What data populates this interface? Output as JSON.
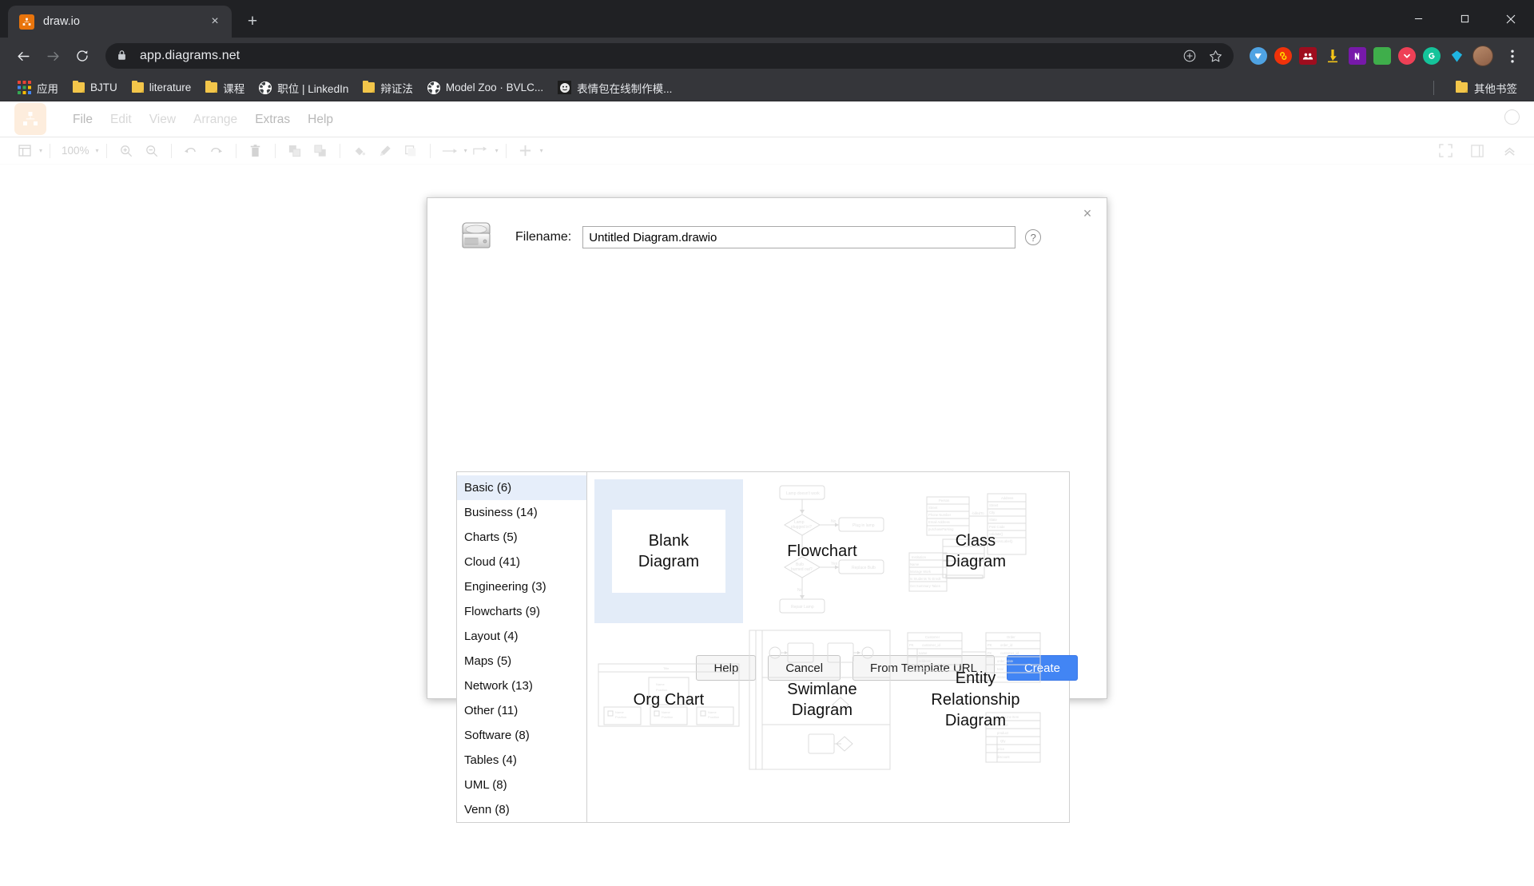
{
  "browser": {
    "tab": {
      "title": "draw.io",
      "favicon": "drawio-icon",
      "close": "×"
    },
    "new_tab_label": "+",
    "window_controls": {
      "minimize": "minimize-icon",
      "maximize": "maximize-icon",
      "close": "close-icon"
    },
    "nav": {
      "back": "back-arrow-icon",
      "forward": "forward-arrow-icon",
      "reload": "reload-icon"
    },
    "omnibox": {
      "url": "app.diagrams.net",
      "lock": "lock-icon",
      "install": "install-app-icon",
      "bookmark": "star-icon"
    },
    "extensions": [
      {
        "name": "extension-blue-v",
        "color": "#4fa3e3"
      },
      {
        "name": "extension-infinity",
        "color": "#f0320a"
      },
      {
        "name": "extension-red-people",
        "color": "#9e0d1e"
      },
      {
        "name": "extension-download",
        "color": "#f5c518"
      },
      {
        "name": "extension-onenote",
        "color": "#7719aa"
      },
      {
        "name": "extension-green",
        "color": "#3fae4b"
      },
      {
        "name": "extension-pocket",
        "color": "#ee4056"
      },
      {
        "name": "extension-grammarly",
        "color": "#15c39a"
      },
      {
        "name": "extension-diamond",
        "color": "#1fb5e2"
      }
    ],
    "profile": "profile-avatar",
    "menu": "three-dot-menu-icon",
    "bookmarks": [
      {
        "label": "应用",
        "icon": "apps-grid-icon"
      },
      {
        "label": "BJTU",
        "icon": "folder-icon"
      },
      {
        "label": "literature",
        "icon": "folder-icon"
      },
      {
        "label": "课程",
        "icon": "folder-icon"
      },
      {
        "label": "职位 | LinkedIn",
        "icon": "globe-icon"
      },
      {
        "label": "辩证法",
        "icon": "folder-icon"
      },
      {
        "label": "Model Zoo · BVLC...",
        "icon": "globe-icon"
      },
      {
        "label": "表情包在线制作模...",
        "icon": "smiley-icon"
      }
    ],
    "other_bookmarks": {
      "label": "其他书签",
      "icon": "folder-icon"
    }
  },
  "drawio": {
    "logo": "drawio-logo",
    "menus": [
      {
        "label": "File",
        "enabled": true
      },
      {
        "label": "Edit",
        "enabled": false
      },
      {
        "label": "View",
        "enabled": false
      },
      {
        "label": "Arrange",
        "enabled": false
      },
      {
        "label": "Extras",
        "enabled": true
      },
      {
        "label": "Help",
        "enabled": true
      }
    ],
    "toolbar": {
      "zoom_level": "100%",
      "icons": [
        "page-view-icon",
        "zoom-in-icon",
        "zoom-out-icon",
        "undo-icon",
        "redo-icon",
        "delete-icon",
        "to-front-icon",
        "to-back-icon",
        "fill-color-icon",
        "line-color-icon",
        "shadow-icon",
        "connection-icon",
        "waypoints-icon",
        "insert-icon"
      ],
      "right_icons": [
        "fullscreen-icon",
        "format-panel-icon",
        "collapse-icon"
      ]
    },
    "language_icon": "globe-icon"
  },
  "dialog": {
    "close_label": "×",
    "storage_icon": "hard-drive-icon",
    "filename_label": "Filename:",
    "filename_value": "Untitled Diagram.drawio",
    "filename_placeholder": "Untitled Diagram.drawio",
    "help_icon": "question-mark-icon",
    "categories": [
      {
        "label": "Basic (6)",
        "selected": true
      },
      {
        "label": "Business (14)",
        "selected": false
      },
      {
        "label": "Charts (5)",
        "selected": false
      },
      {
        "label": "Cloud (41)",
        "selected": false
      },
      {
        "label": "Engineering (3)",
        "selected": false
      },
      {
        "label": "Flowcharts (9)",
        "selected": false
      },
      {
        "label": "Layout (4)",
        "selected": false
      },
      {
        "label": "Maps (5)",
        "selected": false
      },
      {
        "label": "Network (13)",
        "selected": false
      },
      {
        "label": "Other (11)",
        "selected": false
      },
      {
        "label": "Software (8)",
        "selected": false
      },
      {
        "label": "Tables (4)",
        "selected": false
      },
      {
        "label": "UML (8)",
        "selected": false
      },
      {
        "label": "Venn (8)",
        "selected": false
      }
    ],
    "templates": [
      {
        "label": "Blank\nDiagram",
        "art": "blank",
        "selected": true
      },
      {
        "label": "Flowchart",
        "art": "flowchart",
        "selected": false
      },
      {
        "label": "Class\nDiagram",
        "art": "class",
        "selected": false
      },
      {
        "label": "Org Chart",
        "art": "org",
        "selected": false
      },
      {
        "label": "Swimlane\nDiagram",
        "art": "swimlane",
        "selected": false
      },
      {
        "label": "Entity\nRelationship\nDiagram",
        "art": "erd",
        "selected": false
      }
    ],
    "buttons": {
      "help": "Help",
      "cancel": "Cancel",
      "from_template_url": "From Template URL",
      "create": "Create"
    },
    "accent_color": "#4285f4",
    "selected_bg": "#e3ecf8"
  }
}
